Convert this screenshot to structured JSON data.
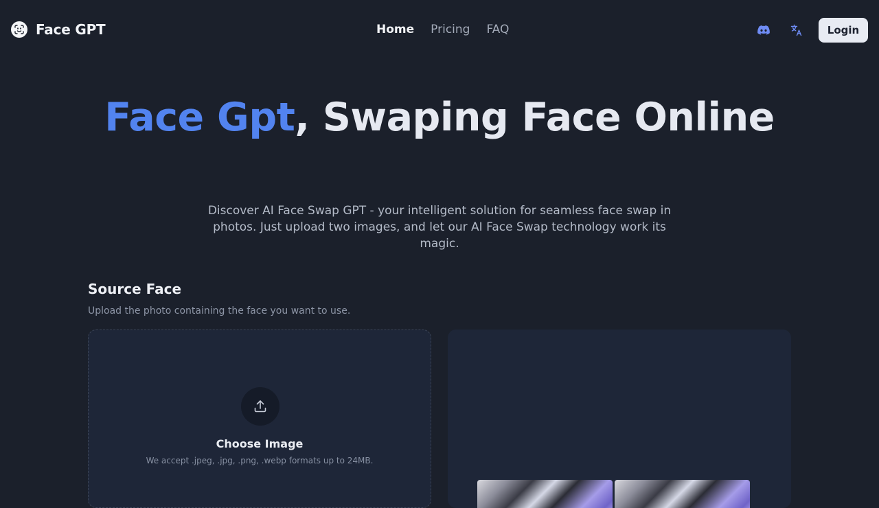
{
  "brand": {
    "name": "Face GPT",
    "logo_icon": "face-scan-icon"
  },
  "nav": {
    "links": [
      {
        "label": "Home",
        "active": true
      },
      {
        "label": "Pricing",
        "active": false
      },
      {
        "label": "FAQ",
        "active": false
      }
    ],
    "discord_icon": "discord-icon",
    "language_icon": "translate-icon",
    "login_label": "Login"
  },
  "hero": {
    "title_accent": "Face Gpt",
    "title_rest": ", Swaping Face Online",
    "description": "Discover AI Face Swap GPT - your intelligent solution for seamless face swap in photos. Just upload two images, and let our AI Face Swap technology work its magic."
  },
  "source": {
    "title": "Source Face",
    "subtitle": "Upload the photo containing the face you want to use.",
    "upload_icon": "upload-icon",
    "choose_label": "Choose Image",
    "accept_hint": "We accept .jpeg, .jpg, .png, .webp formats up to 24MB."
  },
  "colors": {
    "background": "#1b202b",
    "accent": "#5283ef",
    "panel": "#1e2638",
    "button": "#e8ebf3"
  }
}
